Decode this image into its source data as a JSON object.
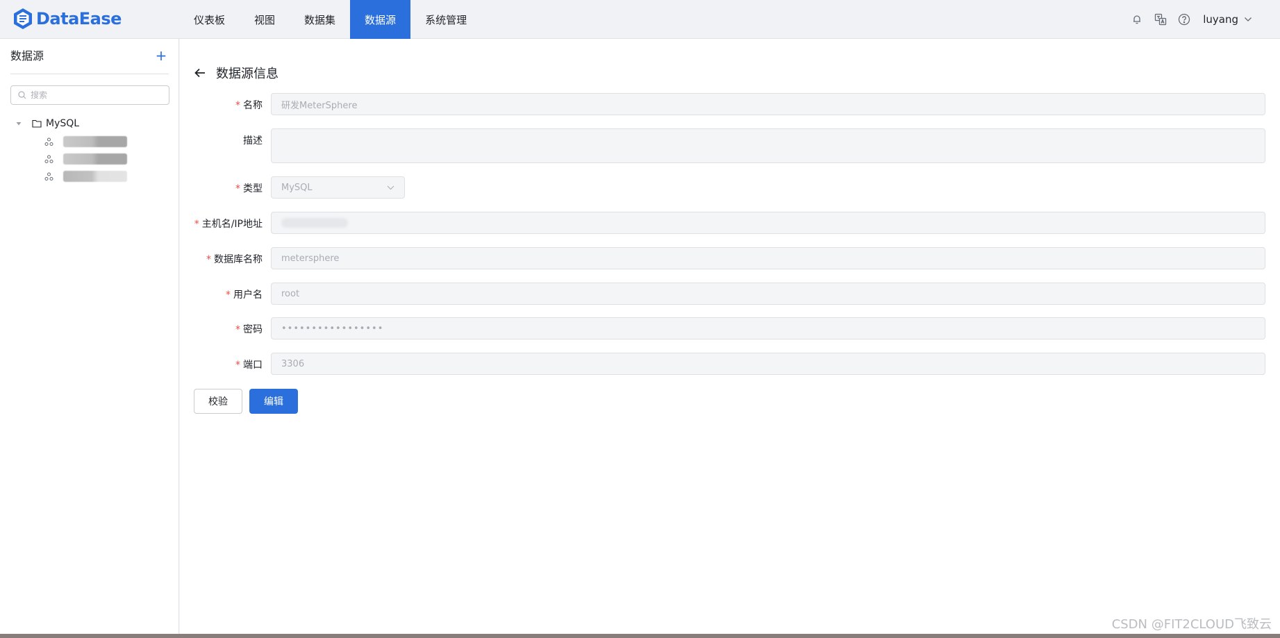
{
  "app": {
    "logo_text": "DataEase",
    "brand_color": "#2a6fdb"
  },
  "nav": {
    "items": [
      {
        "label": "仪表板",
        "active": false
      },
      {
        "label": "视图",
        "active": false
      },
      {
        "label": "数据集",
        "active": false
      },
      {
        "label": "数据源",
        "active": true
      },
      {
        "label": "系统管理",
        "active": false
      }
    ]
  },
  "header": {
    "icons": [
      "bell-icon",
      "translate-icon",
      "help-icon"
    ],
    "username": "luyang"
  },
  "sidebar": {
    "title": "数据源",
    "add_label": "+",
    "search_placeholder": "搜索",
    "tree": {
      "root_label": "MySQL",
      "leaves": [
        "(redacted)",
        "(redacted)",
        "(redacted)"
      ]
    }
  },
  "main": {
    "title": "数据源信息",
    "form": {
      "name": {
        "label": "名称",
        "required": true,
        "value": "研发MeterSphere"
      },
      "description": {
        "label": "描述",
        "required": false,
        "value": ""
      },
      "type": {
        "label": "类型",
        "required": true,
        "value": "MySQL"
      },
      "host": {
        "label": "主机名/IP地址",
        "required": true,
        "value": ""
      },
      "database": {
        "label": "数据库名称",
        "required": true,
        "value": "metersphere"
      },
      "username": {
        "label": "用户名",
        "required": true,
        "value": "root"
      },
      "password": {
        "label": "密码",
        "required": true,
        "value": "•••••••••••••••••"
      },
      "port": {
        "label": "端口",
        "required": true,
        "value": "3306"
      }
    },
    "buttons": {
      "validate_label": "校验",
      "edit_label": "编辑"
    }
  },
  "watermark": "CSDN @FIT2CLOUD飞致云"
}
